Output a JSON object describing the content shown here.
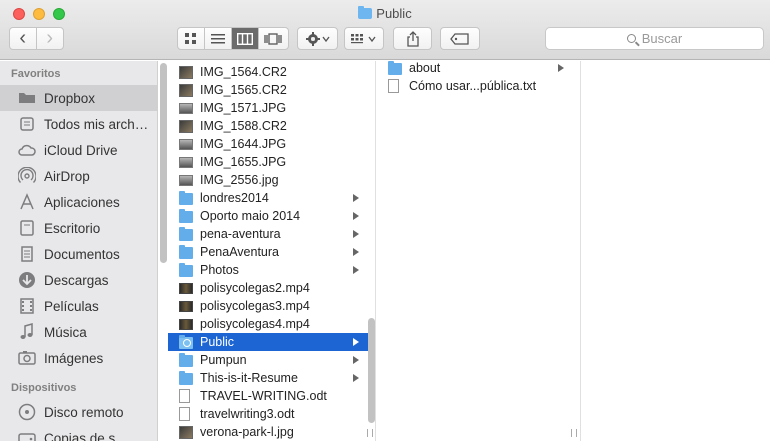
{
  "window": {
    "title": "Public"
  },
  "toolbar": {
    "search_placeholder": "Buscar",
    "back_glyph": "‹",
    "forward_glyph": "›"
  },
  "sidebar": {
    "favorites_header": "Favoritos",
    "favorites": [
      {
        "label": "Dropbox",
        "icon": "dropbox-icon",
        "selected": true
      },
      {
        "label": "Todos mis arch…",
        "icon": "all-files-icon"
      },
      {
        "label": "iCloud Drive",
        "icon": "cloud-icon"
      },
      {
        "label": "AirDrop",
        "icon": "airdrop-icon"
      },
      {
        "label": "Aplicaciones",
        "icon": "applications-icon"
      },
      {
        "label": "Escritorio",
        "icon": "desktop-icon"
      },
      {
        "label": "Documentos",
        "icon": "documents-icon"
      },
      {
        "label": "Descargas",
        "icon": "downloads-icon"
      },
      {
        "label": "Películas",
        "icon": "movies-icon"
      },
      {
        "label": "Música",
        "icon": "music-icon"
      },
      {
        "label": "Imágenes",
        "icon": "pictures-icon"
      }
    ],
    "devices_header": "Dispositivos",
    "devices": [
      {
        "label": "Disco remoto",
        "icon": "remote-disc-icon"
      },
      {
        "label": "Copias de s…",
        "icon": "backup-disk-icon"
      }
    ]
  },
  "column1": [
    {
      "name": "IMG_1564.CR2",
      "type": "img"
    },
    {
      "name": "IMG_1565.CR2",
      "type": "img"
    },
    {
      "name": "IMG_1571.JPG",
      "type": "img2"
    },
    {
      "name": "IMG_1588.CR2",
      "type": "img"
    },
    {
      "name": "IMG_1644.JPG",
      "type": "img2"
    },
    {
      "name": "IMG_1655.JPG",
      "type": "img2"
    },
    {
      "name": "IMG_2556.jpg",
      "type": "img2"
    },
    {
      "name": "londres2014",
      "type": "folder",
      "arrow": true
    },
    {
      "name": "Oporto maio 2014",
      "type": "folder",
      "arrow": true
    },
    {
      "name": "pena-aventura",
      "type": "folder",
      "arrow": true
    },
    {
      "name": "PenaAventura",
      "type": "folder",
      "arrow": true
    },
    {
      "name": "Photos",
      "type": "folder",
      "arrow": true
    },
    {
      "name": "polisycolegas2.mp4",
      "type": "vid"
    },
    {
      "name": "polisycolegas3.mp4",
      "type": "vid"
    },
    {
      "name": "polisycolegas4.mp4",
      "type": "vid"
    },
    {
      "name": "Public",
      "type": "folder pub",
      "arrow": true,
      "selected": true
    },
    {
      "name": "Pumpun",
      "type": "folder",
      "arrow": true
    },
    {
      "name": "This-is-it-Resume",
      "type": "folder",
      "arrow": true
    },
    {
      "name": "TRAVEL-WRITING.odt",
      "type": "doc"
    },
    {
      "name": "travelwriting3.odt",
      "type": "doc"
    },
    {
      "name": "verona-park-l.jpg",
      "type": "img"
    }
  ],
  "column2": [
    {
      "name": "about",
      "type": "folder",
      "arrow": true
    },
    {
      "name": "Cómo usar...pública.txt",
      "type": "doc"
    }
  ]
}
